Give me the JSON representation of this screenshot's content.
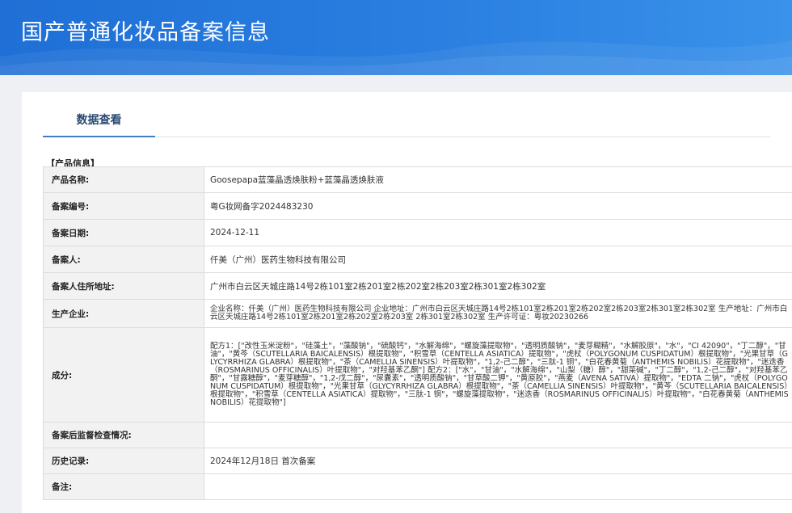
{
  "header": {
    "title": "国产普通化妆品备案信息"
  },
  "tabs": [
    {
      "label": "数据查看"
    }
  ],
  "section": {
    "title": "【产品信息】"
  },
  "rows": [
    {
      "label": "产品名称:",
      "value": "Goosepapa蓝藻晶透焕肤粉+蓝藻晶透焕肤液"
    },
    {
      "label": "备案编号:",
      "value": "粤G妆网备字2024483230"
    },
    {
      "label": "备案日期:",
      "value": "2024-12-11"
    },
    {
      "label": "备案人:",
      "value": "仟美（广州）医药生物科技有限公司"
    },
    {
      "label": "备案人住所地址:",
      "value": "广州市白云区天城庄路14号2栋101室2栋201室2栋202室2栋203室2栋301室2栋302室"
    },
    {
      "label": "生产企业:",
      "value": "企业名称：仟美（广州）医药生物科技有限公司 企业地址：广州市白云区天城庄路14号2栋101室2栋201室2栋202室2栋203室2栋301室2栋302室 生产地址：广州市白云区天城庄路14号2栋101室2栋201室2栋202室2栋203室 2栋301室2栋302室 生产许可证：粤妆20230266"
    },
    {
      "label": "成分:",
      "value": "配方1：[\"改性玉米淀粉\"，\"硅藻土\"，\"藻酸钠\"，\"硫酸钙\"，\"水解海绵\"，\"螺旋藻提取物\"，\"透明质酸钠\"，\"麦芽糊精\"，\"水解胶原\"，\"水\"，\"CI 42090\"，\"丁二醇\"，\"甘油\"，\"黄芩（SCUTELLARIA BAICALENSIS）根提取物\"，\"积雪草（CENTELLA ASIATICA）提取物\"，\"虎杖（POLYGONUM CUSPIDATUM）根提取物\"，\"光果甘草（GLYCYRRHIZA GLABRA）根提取物\"，\"茶（CAMELLIA SINENSIS）叶提取物\"，\"1,2-己二醇\"，\"三肽-1 铜\"，\"白花春黄菊（ANTHEMIS NOBILIS）花提取物\"，\"迷迭香（ROSMARINUS OFFICINALIS）叶提取物\"，\"对羟基苯乙酮\"] 配方2：[\"水\"，\"甘油\"，\"水解海绵\"，\"山梨（糖）醇\"，\"甜菜碱\"，\"丁二醇\"，\"1,2-己二醇\"，\"对羟基苯乙酮\"，\"甘露糖醇\"，\"麦芽糖醇\"，\"1,2-戊二醇\"，\"尿囊素\"，\"透明质酸钠\"，\"甘草酸二钾\"，\"黄原胶\"，\"燕麦（AVENA SATIVA）提取物\"，\"EDTA 二钠\"，\"虎杖（POLYGONUM CUSPIDATUM）根提取物\"，\"光果甘草（GLYCYRRHIZA GLABRA）根提取物\"，\"茶（CAMELLIA SINENSIS）叶提取物\"，\"黄芩（SCUTELLARIA BAICALENSIS）根提取物\"，\"积雪草（CENTELLA ASIATICA）提取物\"，\"三肽-1 铜\"，\"螺旋藻提取物\"，\"迷迭香（ROSMARINUS OFFICINALIS）叶提取物\"，\"白花春黄菊（ANTHEMIS NOBILIS）花提取物\"]"
    },
    {
      "label": "备案后监督检查情况:",
      "value": ""
    },
    {
      "label": "历史记录:",
      "value": "2024年12月18日 首次备案"
    },
    {
      "label": "备注:",
      "value": ""
    }
  ],
  "colors": {
    "header_bg": "#2a7fe0",
    "tab_accent": "#3f7fc6",
    "label_bg": "#f2f2f2"
  }
}
